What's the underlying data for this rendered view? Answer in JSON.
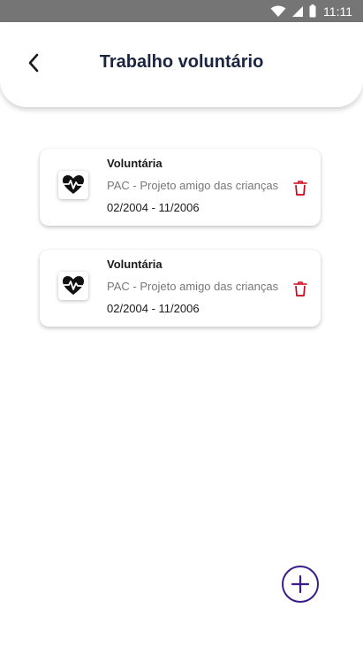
{
  "status_bar": {
    "time": "11:11",
    "icons": [
      "wifi-icon",
      "signal-icon",
      "battery-icon"
    ]
  },
  "header": {
    "title": "Trabalho voluntário",
    "back_icon": "back-arrow-icon"
  },
  "items": [
    {
      "role": "Voluntária",
      "organization": "PAC - Projeto amigo das crianças",
      "period": "02/2004 - 11/2006",
      "icon": "heart-pulse-icon",
      "delete_icon": "trash-icon"
    },
    {
      "role": "Voluntária",
      "organization": "PAC - Projeto amigo das crianças",
      "period": "02/2004 - 11/2006",
      "icon": "heart-pulse-icon",
      "delete_icon": "trash-icon"
    }
  ],
  "add_button": {
    "icon": "plus-icon"
  },
  "colors": {
    "status_bar": "#757575",
    "title": "#1b2540",
    "delete": "#d0021b",
    "add_button": "#3a1c8a",
    "secondary_text": "#777777"
  }
}
